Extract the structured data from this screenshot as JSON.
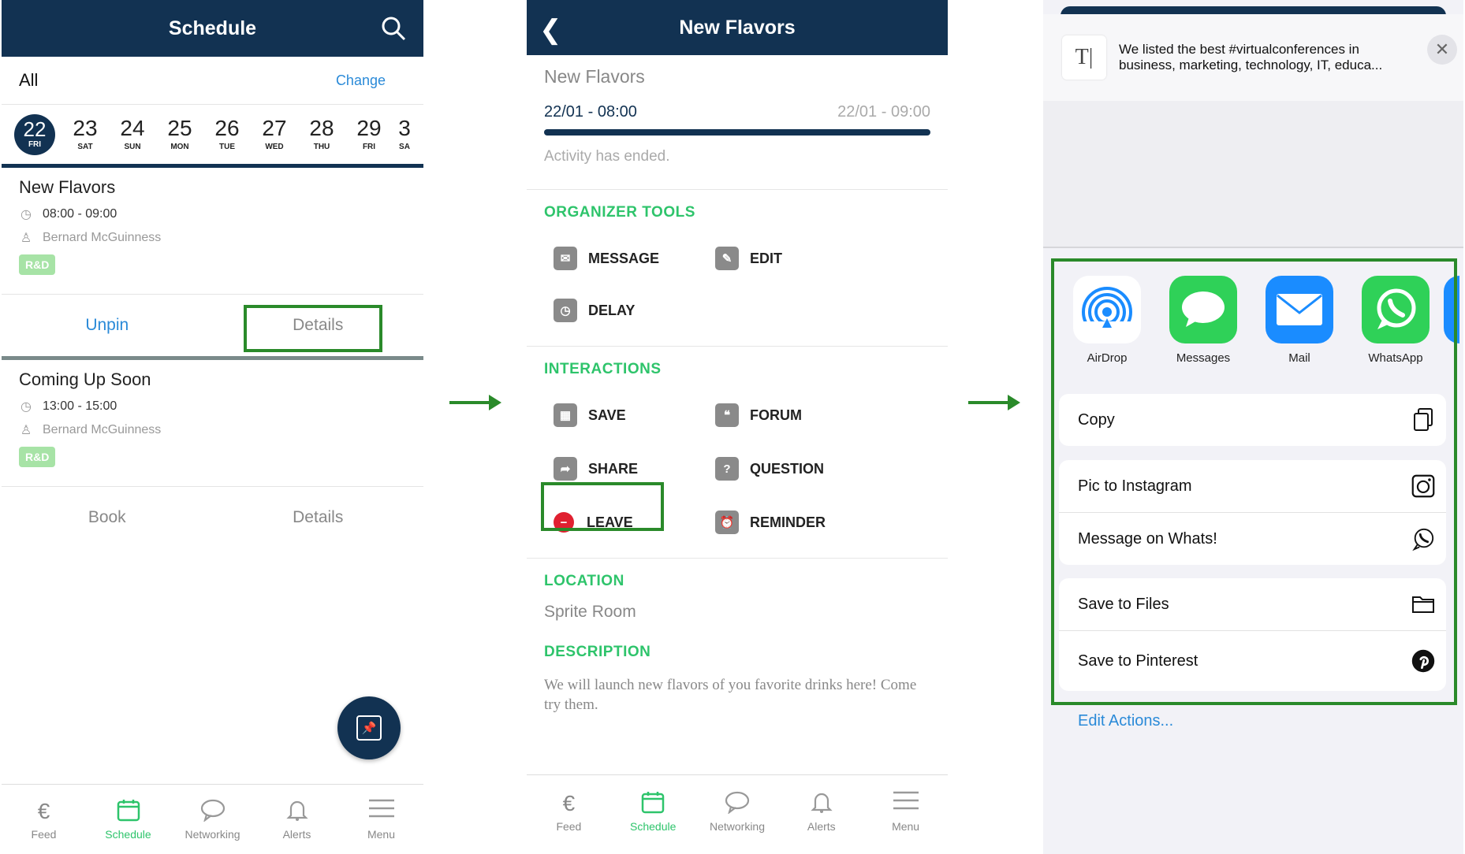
{
  "colors": {
    "navy": "#123252",
    "accent_green": "#2ec46b",
    "link_blue": "#2a8ad8",
    "highlight": "#2a8a2a"
  },
  "schedule": {
    "title": "Schedule",
    "filter_label": "All",
    "change_label": "Change",
    "dates": [
      {
        "day": "22",
        "weekday": "FRI",
        "selected": true
      },
      {
        "day": "23",
        "weekday": "SAT"
      },
      {
        "day": "24",
        "weekday": "SUN"
      },
      {
        "day": "25",
        "weekday": "MON"
      },
      {
        "day": "26",
        "weekday": "TUE"
      },
      {
        "day": "27",
        "weekday": "WED"
      },
      {
        "day": "28",
        "weekday": "THU"
      },
      {
        "day": "29",
        "weekday": "FRI"
      },
      {
        "day": "3",
        "weekday": "SA"
      }
    ],
    "events": [
      {
        "title": "New Flavors",
        "time": "08:00 - 09:00",
        "speaker": "Bernard McGuinness",
        "tag": "R&D",
        "action_left": "Unpin",
        "action_right": "Details"
      },
      {
        "title": "Coming Up Soon",
        "time": "13:00 - 15:00",
        "speaker": "Bernard McGuinness",
        "tag": "R&D",
        "action_left": "Book",
        "action_right": "Details"
      }
    ]
  },
  "tabbar": [
    {
      "icon": "euro-icon",
      "label": "Feed"
    },
    {
      "icon": "calendar-icon",
      "label": "Schedule",
      "active": true
    },
    {
      "icon": "chat-bubble-icon",
      "label": "Networking"
    },
    {
      "icon": "bell-icon",
      "label": "Alerts"
    },
    {
      "icon": "hamburger-menu-icon",
      "label": "Menu"
    }
  ],
  "detail": {
    "nav_title": "New Flavors",
    "title": "New Flavors",
    "start": "22/01 - 08:00",
    "end": "22/01 - 09:00",
    "progress": 1.0,
    "status": "Activity has ended.",
    "organizer_title": "ORGANIZER TOOLS",
    "organizer_tools": [
      "MESSAGE",
      "EDIT",
      "DELAY"
    ],
    "interactions_title": "INTERACTIONS",
    "interactions": [
      "SAVE",
      "FORUM",
      "SHARE",
      "QUESTION",
      "LEAVE",
      "REMINDER"
    ],
    "location_title": "LOCATION",
    "location": "Sprite Room",
    "description_title": "DESCRIPTION",
    "description": "We will launch new flavors of you favorite drinks here! Come try them."
  },
  "share": {
    "preview_icon": "T|",
    "preview_text": "We listed the best #virtualconferences in business, marketing, technology, IT, educa...",
    "apps": [
      {
        "icon": "airdrop-icon",
        "label": "AirDrop",
        "color": "#ffffff"
      },
      {
        "icon": "messages-icon",
        "label": "Messages",
        "color": "#2fd158"
      },
      {
        "icon": "mail-icon",
        "label": "Mail",
        "color": "#1a8cff"
      },
      {
        "icon": "whatsapp-icon",
        "label": "WhatsApp",
        "color": "#2fd158"
      }
    ],
    "actions": [
      "Copy",
      "Pic to Instagram",
      "Message on Whats!",
      "Save to Files",
      "Save to Pinterest"
    ],
    "edit_actions": "Edit Actions..."
  }
}
